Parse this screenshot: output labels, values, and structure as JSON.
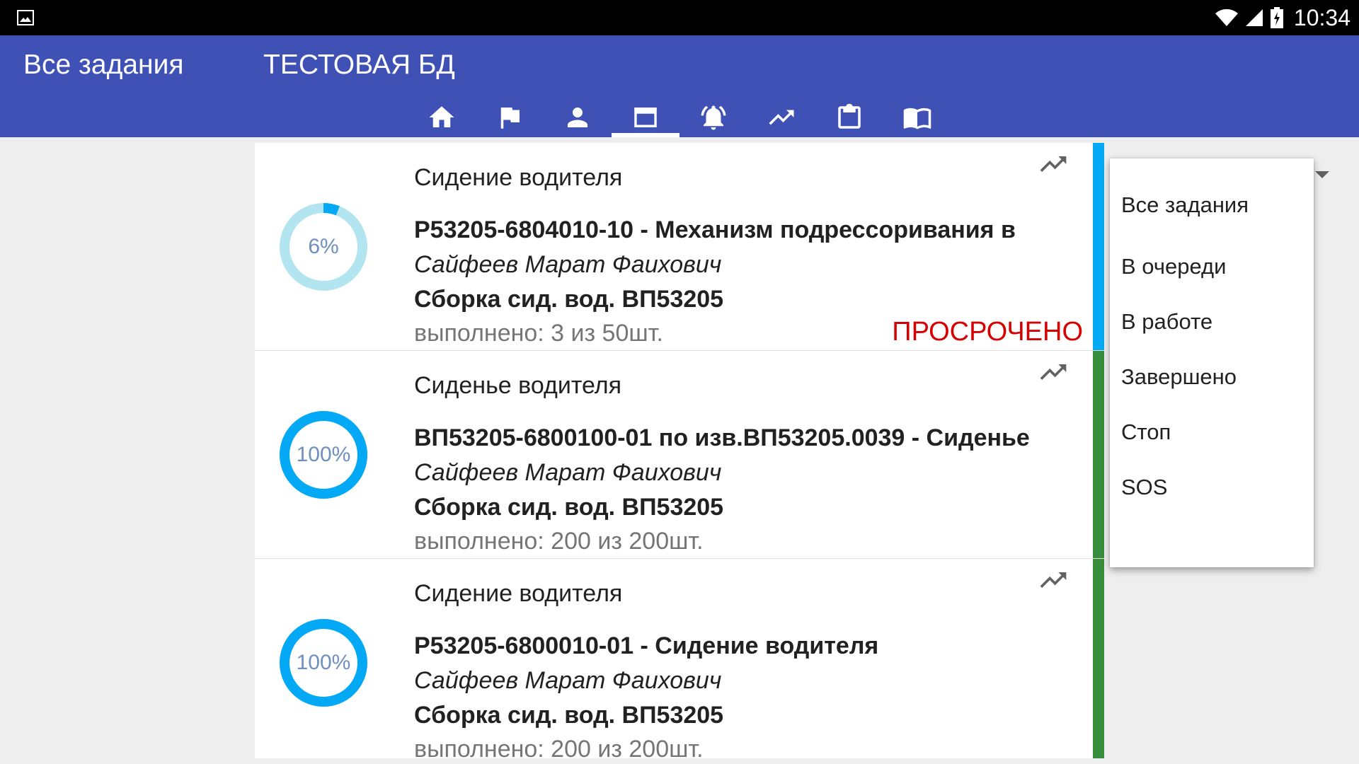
{
  "status_bar": {
    "time": "10:34",
    "icons": [
      "gallery-icon",
      "wifi-icon",
      "signal-icon",
      "battery-charging-icon"
    ]
  },
  "app_bar": {
    "title": "Все задания",
    "database": "ТЕСТОВАЯ БД",
    "tabs": [
      {
        "icon": "home-icon"
      },
      {
        "icon": "flag-icon"
      },
      {
        "icon": "person-icon"
      },
      {
        "icon": "tasks-card-icon",
        "active": true
      },
      {
        "icon": "alarm-bell-icon"
      },
      {
        "icon": "trending-up-icon"
      },
      {
        "icon": "clipboard-icon"
      },
      {
        "icon": "book-icon"
      }
    ]
  },
  "tasks": [
    {
      "group": "Сидение водителя",
      "name": "Р53205-6804010-10 - Механизм подрессоривания в",
      "worker": "Сайфеев Марат Фаихович",
      "operation": "Сборка сид. вод. ВП53205",
      "done": "выполнено: 3 из 50шт.",
      "progress_label": "6%",
      "progress": 0.06,
      "overdue": "ПРОСРОЧЕНО",
      "strip_color": "#03a9f4"
    },
    {
      "group": "Сиденье водителя",
      "name": "ВП53205-6800100-01 по изв.ВП53205.0039 - Сиденье",
      "worker": "Сайфеев Марат Фаихович",
      "operation": "Сборка сид. вод. ВП53205",
      "done": "выполнено: 200 из 200шт.",
      "progress_label": "100%",
      "progress": 1.0,
      "overdue": "",
      "strip_color": "#388e3c"
    },
    {
      "group": "Сидение водителя",
      "name": "Р53205-6800010-01 - Сидение водителя",
      "worker": "Сайфеев Марат Фаихович",
      "operation": "Сборка сид. вод. ВП53205",
      "done": "выполнено: 200 из 200шт.",
      "progress_label": "100%",
      "progress": 1.0,
      "overdue": "",
      "strip_color": "#388e3c"
    }
  ],
  "filter_menu": {
    "items": [
      "Все задания",
      "В очереди",
      "В работе",
      "Завершено",
      "Стоп",
      "SOS"
    ]
  },
  "colors": {
    "primary": "#3f51b5",
    "progress_fg": "#03a9f4",
    "progress_bg": "#b3e5f0",
    "overdue": "#d50000",
    "in_progress_strip": "#03a9f4",
    "done_strip": "#388e3c"
  }
}
